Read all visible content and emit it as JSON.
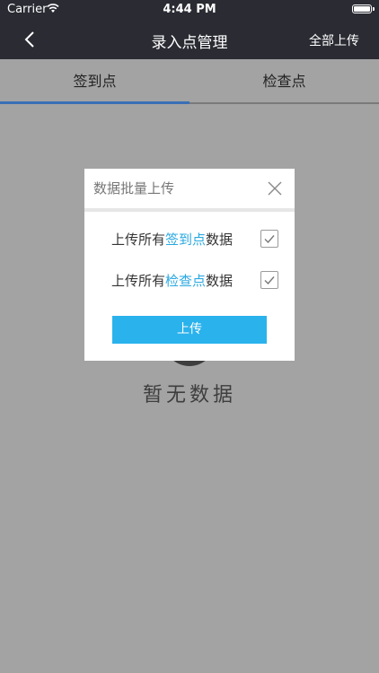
{
  "status_bar": {
    "carrier": "Carrier",
    "time": "4:44 PM"
  },
  "nav": {
    "title": "录入点管理",
    "right_action": "全部上传"
  },
  "tabs": [
    {
      "label": "签到点",
      "selected": true
    },
    {
      "label": "检查点",
      "selected": false
    }
  ],
  "empty_state": {
    "text": "暂无数据"
  },
  "dialog": {
    "title": "数据批量上传",
    "rows": [
      {
        "prefix": "上传所有",
        "highlight": "签到点",
        "suffix": "数据",
        "checked": true
      },
      {
        "prefix": "上传所有",
        "highlight": "检查点",
        "suffix": "数据",
        "checked": true
      }
    ],
    "upload_label": "上传"
  },
  "colors": {
    "nav_bg": "#2a2b33",
    "overlay": "#a3a3a3",
    "accent": "#2ab2ec",
    "tab_indicator": "#3a6fb6"
  }
}
